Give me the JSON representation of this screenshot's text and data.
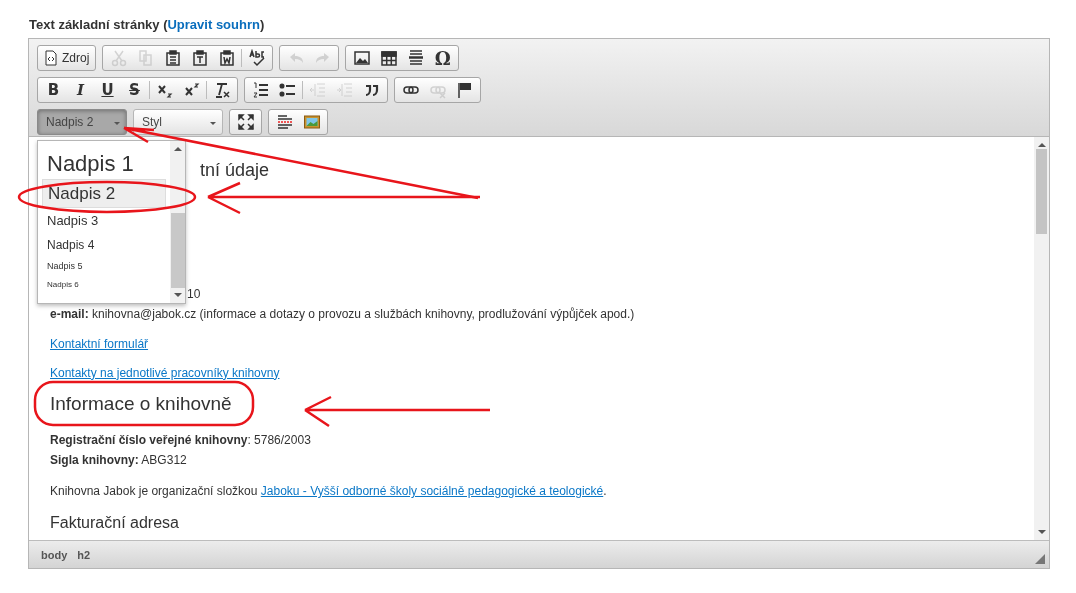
{
  "field_label": {
    "text": "Text základní stránky (",
    "link": "Upravit souhrn",
    "suffix": ")"
  },
  "toolbar": {
    "rows": [
      [
        {
          "items": [
            {
              "kind": "source",
              "label": "Zdroj",
              "disabled": false
            }
          ]
        },
        {
          "items": [
            {
              "kind": "cut",
              "disabled": true
            },
            {
              "kind": "copy",
              "disabled": true
            },
            {
              "kind": "paste",
              "disabled": false
            },
            {
              "kind": "paste-text",
              "disabled": false
            },
            {
              "kind": "paste-word",
              "disabled": false
            },
            {
              "kind": "sep"
            },
            {
              "kind": "spellcheck",
              "disabled": false
            }
          ]
        },
        {
          "items": [
            {
              "kind": "undo",
              "disabled": true
            },
            {
              "kind": "redo",
              "disabled": true
            }
          ]
        },
        {
          "items": [
            {
              "kind": "image",
              "disabled": false
            },
            {
              "kind": "table",
              "disabled": false
            },
            {
              "kind": "hr",
              "disabled": false
            },
            {
              "kind": "glyph",
              "label": "Ω",
              "disabled": false
            }
          ]
        }
      ],
      [
        {
          "items": [
            {
              "kind": "bold",
              "label": "B",
              "disabled": false
            },
            {
              "kind": "italic",
              "label": "I",
              "disabled": false
            },
            {
              "kind": "underline",
              "label": "U",
              "disabled": false
            },
            {
              "kind": "strike",
              "label": "S",
              "disabled": false
            },
            {
              "kind": "sep"
            },
            {
              "kind": "subscript",
              "disabled": false
            },
            {
              "kind": "superscript",
              "disabled": false
            },
            {
              "kind": "sep"
            },
            {
              "kind": "removeformat",
              "disabled": false
            }
          ]
        },
        {
          "items": [
            {
              "kind": "numlist",
              "disabled": false
            },
            {
              "kind": "bullist",
              "disabled": false
            },
            {
              "kind": "sep"
            },
            {
              "kind": "outdent",
              "disabled": true
            },
            {
              "kind": "indent",
              "disabled": true
            },
            {
              "kind": "blockquote",
              "disabled": false
            }
          ]
        },
        {
          "items": [
            {
              "kind": "link",
              "disabled": false
            },
            {
              "kind": "unlink",
              "disabled": true
            },
            {
              "kind": "anchor",
              "disabled": false
            }
          ]
        }
      ],
      [
        {
          "items": [
            {
              "kind": "combo",
              "label": "Nadpis 2",
              "expanded": true
            },
            {
              "kind": "combo",
              "label": "Styl",
              "expanded": false
            }
          ]
        },
        {
          "items": [
            {
              "kind": "maximize",
              "disabled": false
            }
          ]
        },
        {
          "items": [
            {
              "kind": "showblocks",
              "disabled": false
            },
            {
              "kind": "picture",
              "disabled": false
            }
          ]
        }
      ]
    ]
  },
  "format_menu": [
    {
      "label": "Nadpis 1",
      "kind": "h1",
      "selected": false
    },
    {
      "label": "Nadpis 2",
      "kind": "h2",
      "selected": true
    },
    {
      "label": "Nadpis 3",
      "kind": "h3",
      "selected": false
    },
    {
      "label": "Nadpis 4",
      "kind": "h4",
      "selected": false
    },
    {
      "label": "Nadpis 5",
      "kind": "h5",
      "selected": false
    },
    {
      "label": "Nadpis 6",
      "kind": "h6",
      "selected": false
    }
  ],
  "content": [
    {
      "kind": "heading_fragment",
      "text": "tní údaje"
    },
    {
      "kind": "text_fragment",
      "text": "10"
    },
    {
      "kind": "rich",
      "text": "**e-mail:** knihovna@jabok.cz (informace a dotazy o provozu a službách knihovny, prodlužování výpůjček apod.)"
    },
    {
      "kind": "link",
      "text": "Kontaktní formulář"
    },
    {
      "kind": "link",
      "text": "Kontakty na jednotlivé pracovníky knihovny"
    },
    {
      "kind": "h2",
      "text": "Informace o knihovně"
    },
    {
      "kind": "lines",
      "lines": [
        "**Registrační číslo veřejné knihovny**: 5786/2003",
        "**Sigla knihovny:** ABG312"
      ]
    },
    {
      "kind": "paragraph",
      "parts": [
        {
          "text": "Knihovna Jabok je  organizační složkou ",
          "link": false
        },
        {
          "text": "Jaboku - Vyšší odborné školy sociálně pedagogické a teologické",
          "link": true
        },
        {
          "text": ".",
          "link": false
        }
      ]
    },
    {
      "kind": "h3",
      "text": "Fakturační adresa"
    }
  ],
  "status_bar": {
    "path": [
      "body",
      "h2"
    ]
  }
}
